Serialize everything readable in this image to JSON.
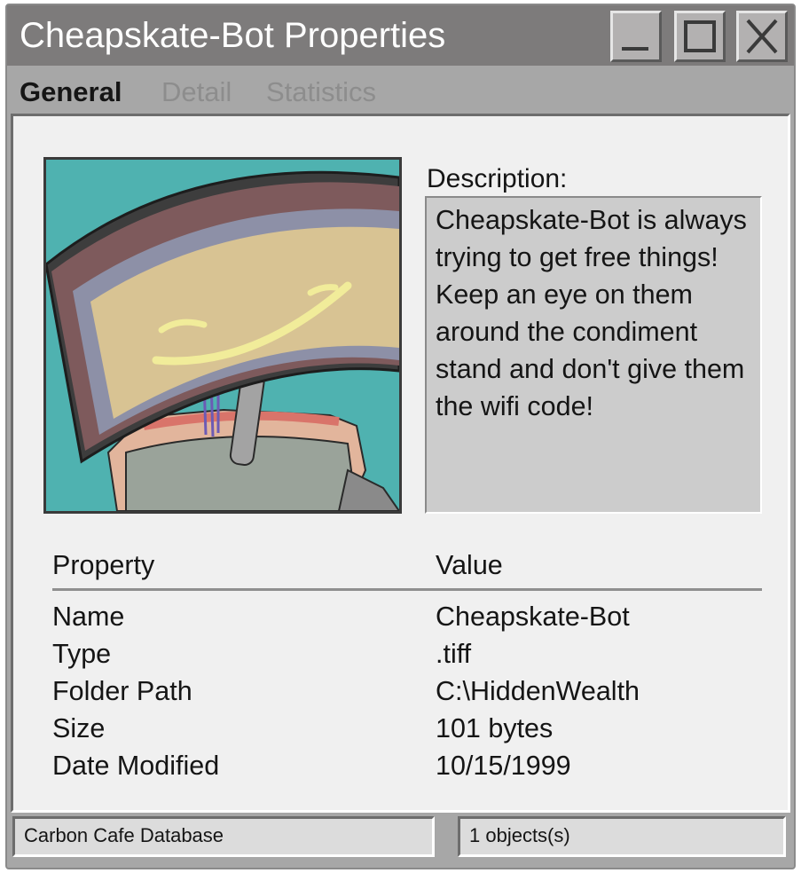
{
  "window": {
    "title": "Cheapskate-Bot Properties",
    "controls": [
      "minimize-icon",
      "maximize-icon",
      "close-icon"
    ]
  },
  "tabs": [
    {
      "label": "General",
      "active": true
    },
    {
      "label": "Detail",
      "active": false
    },
    {
      "label": "Statistics",
      "active": false
    }
  ],
  "description": {
    "label": "Description:",
    "text": "Cheapskate-Bot is always trying to get free things! Keep an eye on them around the condiment stand and don't give them the wifi code!"
  },
  "properties": {
    "header": {
      "property": "Property",
      "value": "Value"
    },
    "rows": [
      {
        "property": "Name",
        "value": "Cheapskate-Bot"
      },
      {
        "property": "Type",
        "value": ".tiff"
      },
      {
        "property": "Folder Path",
        "value": "C:\\HiddenWealth"
      },
      {
        "property": "Size",
        "value": "101 bytes"
      },
      {
        "property": "Date Modified",
        "value": "10/15/1999"
      }
    ]
  },
  "statusbar": {
    "left": "Carbon Cafe Database",
    "right": "1 objects(s)"
  },
  "colors": {
    "titlebar": "#7d7b7b",
    "window": "#a7a7a7",
    "panel": "#f0f0f0",
    "picture_bg": "#4fb2b0",
    "desc_box": "#cccccc"
  }
}
